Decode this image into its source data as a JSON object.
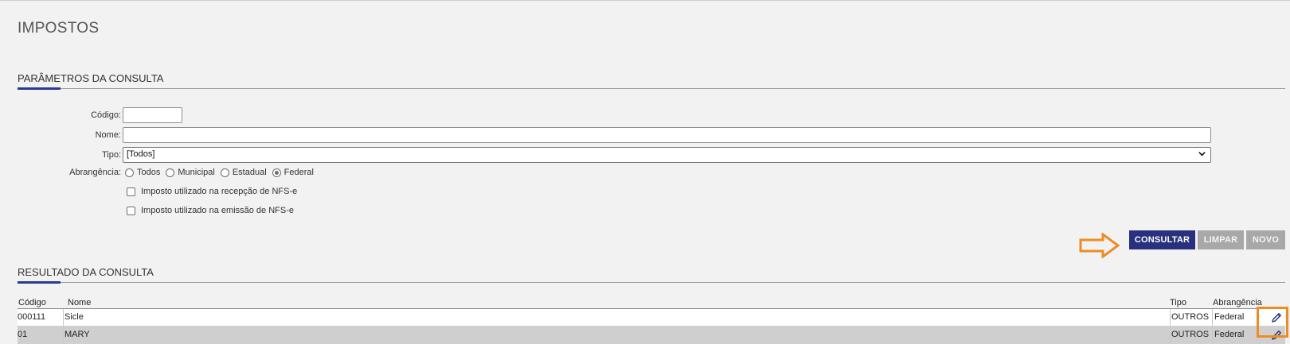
{
  "page": {
    "title": "IMPOSTOS"
  },
  "params": {
    "header": "PARÂMETROS DA CONSULTA",
    "codigo_label": "Código:",
    "codigo_value": "",
    "nome_label": "Nome:",
    "nome_value": "",
    "tipo_label": "Tipo:",
    "tipo_selected": "[Todos]",
    "abrangencia_label": "Abrangência:",
    "abrangencia_options": [
      "Todos",
      "Municipal",
      "Estadual",
      "Federal"
    ],
    "abrangencia_selected": "Federal",
    "checkbox_recepcao": "Imposto utilizado na recepção de NFS-e",
    "checkbox_emissao": "Imposto utilizado na emissão de NFS-e"
  },
  "actions": {
    "consultar": "CONSULTAR",
    "limpar": "LIMPAR",
    "novo": "NOVO"
  },
  "results": {
    "header": "RESULTADO DA CONSULTA",
    "columns": [
      "Código",
      "Nome",
      "Tipo",
      "Abrangência"
    ],
    "rows": [
      {
        "codigo": "000111",
        "nome": "Sicle",
        "tipo": "OUTROS",
        "abrangencia": "Federal"
      },
      {
        "codigo": "01",
        "nome": "MARY",
        "tipo": "OUTROS",
        "abrangencia": "Federal"
      }
    ]
  },
  "icons": {
    "edit": "pencil-icon",
    "annotation": "arrow-right-icon"
  },
  "colors": {
    "primary": "#29307e",
    "accent": "#2b3a8c",
    "annotation": "#f08a24",
    "disabled": "#a8a8a8"
  }
}
